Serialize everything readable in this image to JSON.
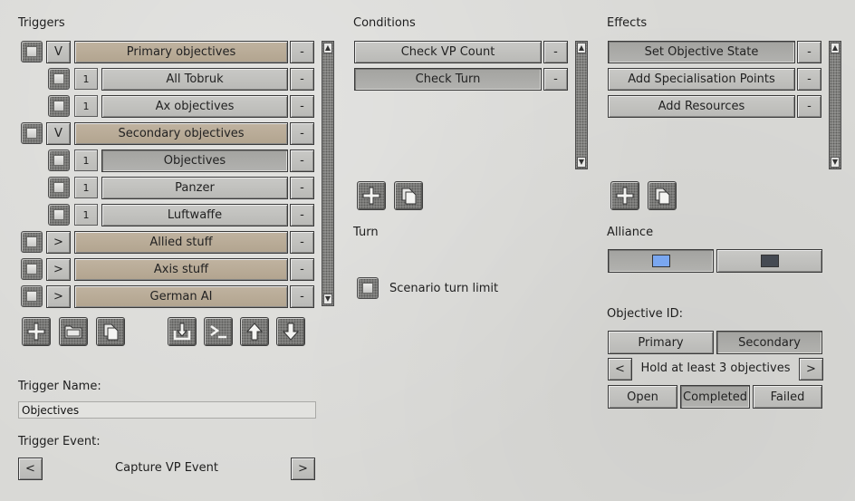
{
  "triggers": {
    "title": "Triggers",
    "rows": [
      {
        "label": "Primary objectives",
        "expand": "V",
        "kind": "group",
        "style": "tan"
      },
      {
        "label": "All Tobruk",
        "num": "1",
        "kind": "child",
        "style": "grey"
      },
      {
        "label": "Ax objectives",
        "num": "1",
        "kind": "child",
        "style": "grey"
      },
      {
        "label": "Secondary objectives",
        "expand": "V",
        "kind": "group",
        "style": "tan"
      },
      {
        "label": "Objectives",
        "num": "1",
        "kind": "child",
        "style": "grey",
        "selected": true
      },
      {
        "label": "Panzer",
        "num": "1",
        "kind": "child",
        "style": "grey"
      },
      {
        "label": "Luftwaffe",
        "num": "1",
        "kind": "child",
        "style": "grey"
      },
      {
        "label": "Allied stuff",
        "expand": ">",
        "kind": "group",
        "style": "tan"
      },
      {
        "label": "Axis stuff",
        "expand": ">",
        "kind": "group",
        "style": "tan"
      },
      {
        "label": "German AI",
        "expand": ">",
        "kind": "group",
        "style": "tan"
      }
    ],
    "remove_label": "-"
  },
  "trigger_name": {
    "label": "Trigger Name:",
    "value": "Objectives"
  },
  "trigger_event": {
    "label": "Trigger Event:",
    "value": "Capture VP Event",
    "prev": "<",
    "next": ">"
  },
  "conditions": {
    "title": "Conditions",
    "rows": [
      {
        "label": "Check VP Count"
      },
      {
        "label": "Check Turn"
      }
    ],
    "remove_label": "-"
  },
  "turn": {
    "title": "Turn",
    "scenario_turn_limit": "Scenario turn limit"
  },
  "effects": {
    "title": "Effects",
    "rows": [
      {
        "label": "Set Objective State"
      },
      {
        "label": "Add Specialisation Points"
      },
      {
        "label": "Add Resources"
      }
    ],
    "remove_label": "-"
  },
  "alliance": {
    "title": "Alliance",
    "colors": [
      "#7aa7f0",
      "#454a52"
    ]
  },
  "objective": {
    "title": "Objective ID:",
    "primary": "Primary",
    "secondary": "Secondary",
    "description": "Hold at least 3 objectives",
    "prev": "<",
    "next": ">",
    "states": [
      "Open",
      "Completed",
      "Failed"
    ]
  },
  "icons": [
    "add-icon",
    "folder-icon",
    "copy-icon",
    "import-icon",
    "console-icon",
    "move-up-icon",
    "move-down-icon"
  ]
}
